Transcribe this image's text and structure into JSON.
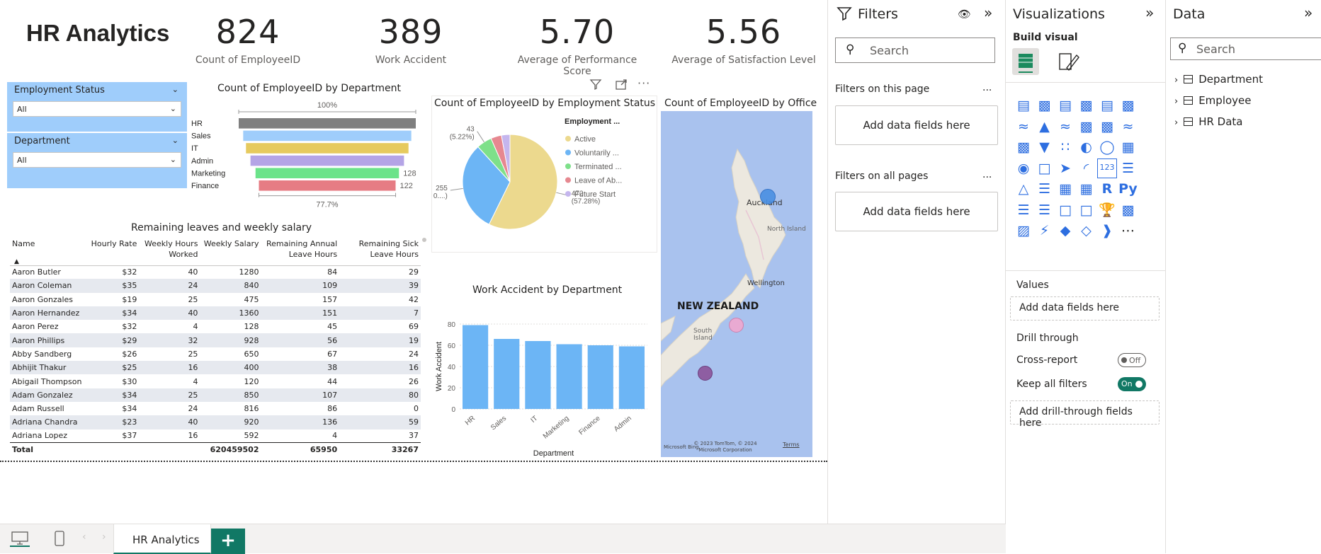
{
  "report": {
    "title": "HR Analytics",
    "kpis": [
      {
        "value": "824",
        "label": "Count of EmployeeID"
      },
      {
        "value": "389",
        "label": "Work Accident"
      },
      {
        "value": "5.70",
        "label": "Average of Performance Score"
      },
      {
        "value": "5.56",
        "label": "Average of Satisfaction Level"
      }
    ],
    "slicers": [
      {
        "title": "Employment Status",
        "value": "All"
      },
      {
        "title": "Department",
        "value": "All"
      }
    ]
  },
  "chart_data": [
    {
      "type": "funnel",
      "title": "Count of EmployeeID by Department",
      "categories": [
        "HR",
        "Sales",
        "IT",
        "Admin",
        "Marketing",
        "Finance"
      ],
      "values": [
        158,
        150,
        145,
        137,
        128,
        122
      ],
      "colors": [
        "#7f7f7f",
        "#9fcdfb",
        "#e6ca5e",
        "#b4a4e6",
        "#6be38a",
        "#e67c84"
      ],
      "top_label": "100%",
      "bottom_label": "77.7%",
      "data_labels": [
        {
          "category": "Marketing",
          "text": "128"
        },
        {
          "category": "Finance",
          "text": "122"
        }
      ]
    },
    {
      "type": "pie",
      "title": "Count of EmployeeID by Employment Status",
      "legend_title": "Employment ...",
      "legend_position": "right",
      "slices": [
        {
          "name": "Active",
          "legend": "Active",
          "value": 472,
          "color": "#ecd98e"
        },
        {
          "name": "Voluntarily Terminated",
          "legend": "Voluntarily ...",
          "value": 255,
          "color": "#6cb5f5"
        },
        {
          "name": "Terminated for Cause",
          "legend": "Terminated ...",
          "value": 43,
          "color": "#7ee08a"
        },
        {
          "name": "Leave of Absence",
          "legend": "Leave of Ab...",
          "value": 30,
          "color": "#e68890"
        },
        {
          "name": "Future Start",
          "legend": "Future Start",
          "value": 24,
          "color": "#c5b6ee"
        }
      ],
      "data_labels": [
        {
          "slice": "Active",
          "lines": [
            "472",
            "(57.28%)"
          ]
        },
        {
          "slice": "Voluntarily Terminated",
          "lines": [
            "255",
            "(30....)"
          ]
        },
        {
          "slice": "Terminated for Cause",
          "lines": [
            "43",
            "(5.22%)"
          ]
        }
      ]
    },
    {
      "type": "bar",
      "title": "Work Accident by Department",
      "xlabel": "Department",
      "ylabel": "Work Accident",
      "ylim": [
        0,
        80
      ],
      "yticks": [
        0,
        20,
        40,
        60,
        80
      ],
      "categories": [
        "HR",
        "Sales",
        "IT",
        "Marketing",
        "Finance",
        "Admin"
      ],
      "values": [
        79,
        66,
        64,
        61,
        60,
        59
      ],
      "color": "#6cb5f5"
    }
  ],
  "table": {
    "title": "Remaining leaves and weekly salary",
    "columns": [
      "Name",
      "Hourly Rate",
      "Weekly Hours Worked",
      "Weekly Salary",
      "Remaining Annual Leave Hours",
      "Remaining Sick Leave Hours"
    ],
    "rows": [
      [
        "Aaron Butler",
        "$32",
        "40",
        "1280",
        "84",
        "29"
      ],
      [
        "Aaron Coleman",
        "$35",
        "24",
        "840",
        "109",
        "39"
      ],
      [
        "Aaron Gonzales",
        "$19",
        "25",
        "475",
        "157",
        "42"
      ],
      [
        "Aaron Hernandez",
        "$34",
        "40",
        "1360",
        "151",
        "7"
      ],
      [
        "Aaron Perez",
        "$32",
        "4",
        "128",
        "45",
        "69"
      ],
      [
        "Aaron Phillips",
        "$29",
        "32",
        "928",
        "56",
        "19"
      ],
      [
        "Abby Sandberg",
        "$26",
        "25",
        "650",
        "67",
        "24"
      ],
      [
        "Abhijit Thakur",
        "$25",
        "16",
        "400",
        "38",
        "16"
      ],
      [
        "Abigail Thompson",
        "$30",
        "4",
        "120",
        "44",
        "26"
      ],
      [
        "Adam Gonzalez",
        "$34",
        "25",
        "850",
        "107",
        "80"
      ],
      [
        "Adam Russell",
        "$34",
        "24",
        "816",
        "86",
        "0"
      ],
      [
        "Adriana Chandra",
        "$23",
        "40",
        "920",
        "136",
        "59"
      ],
      [
        "Adriana Lopez",
        "$37",
        "16",
        "592",
        "4",
        "37"
      ]
    ],
    "total": [
      "Total",
      "",
      "",
      "620459502",
      "65950",
      "33267"
    ]
  },
  "map": {
    "title": "Count of EmployeeID by Office",
    "country_label": "NEW ZEALAND",
    "places": [
      "Auckland",
      "North Island",
      "Wellington",
      "South Island"
    ],
    "bubble_colors": [
      "#4a90e2",
      "#f0a8d0",
      "#8e5ea2"
    ],
    "attribution": "© 2023 TomTom, © 2024 Microsoft Corporation",
    "terms": "Terms",
    "bing": "Microsoft Bing"
  },
  "filters": {
    "title": "Filters",
    "search_placeholder": "Search",
    "on_page": "Filters on this page",
    "on_all": "Filters on all pages",
    "add_fields": "Add data fields here",
    "more": "..."
  },
  "visualizations": {
    "title": "Visualizations",
    "build_visual": "Build visual",
    "values_label": "Values",
    "add_fields": "Add data fields here",
    "drill_through": "Drill through",
    "cross_report": "Cross-report",
    "cross_report_state": "Off",
    "keep_filters": "Keep all filters",
    "keep_filters_state": "On",
    "add_drill": "Add drill-through fields here",
    "icons": [
      "stacked-bar",
      "stacked-column",
      "clustered-bar",
      "clustered-column",
      "100-bar",
      "100-column",
      "line",
      "area",
      "stacked-area",
      "line-column",
      "line-clustered",
      "ribbon",
      "waterfall",
      "funnel",
      "scatter",
      "pie",
      "donut",
      "treemap",
      "map",
      "filled-map",
      "azure-map",
      "gauge",
      "card",
      "multirow-card",
      "kpi",
      "slicer",
      "table",
      "matrix",
      "r-visual",
      "python-visual",
      "key-influencers",
      "decomposition-tree",
      "qa",
      "paginated",
      "trophy",
      "smart-narrative",
      "power-apps",
      "power-automate",
      "custom-1",
      "diamond",
      "chevrons",
      "more"
    ]
  },
  "data_pane": {
    "title": "Data",
    "search_placeholder": "Search",
    "tables": [
      "Department",
      "Employee",
      "HR Data"
    ]
  },
  "tabs": {
    "page": "HR Analytics",
    "add": "+"
  },
  "visual_header": {
    "more": "···"
  }
}
